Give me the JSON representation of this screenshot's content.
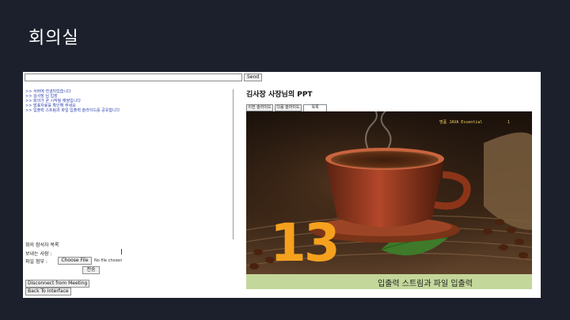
{
  "page": {
    "title": "회의실"
  },
  "chat": {
    "input_value": "",
    "send_label": "Send",
    "messages": [
      ">> 서버에 연결되었습니다",
      ">> 김사장 님 입장",
      ">> 회의가 곧 시작될 예정입니다",
      ">> 발표자료를 확인해 주세요",
      ">> 입출력 스트림과 파일 입출력 슬라이드를 공유합니다"
    ]
  },
  "form": {
    "attendance_label": "회의 참석자 목록",
    "name_label": "보내는 사람 :",
    "name_value": "",
    "file_label": "파일 첨부 :",
    "choose_file_label": "Choose File",
    "no_file_label": "No file chosen",
    "submit_label": "전송",
    "disconnect_label": "Disconnect from Meeting",
    "back_label": "Back To Interface"
  },
  "presentation": {
    "title": "김사장 사장님의 PPT",
    "tabs": [
      "이전 슬라이드",
      "다음 슬라이드",
      "목록"
    ],
    "active_tab": 2,
    "slide": {
      "header": "명품 JAVA Essential",
      "page": "1",
      "number": "13",
      "footer": "입출력 스트림과 파일 입출력",
      "colors": {
        "number": "#f5a11e",
        "footer_bg": "#c4d79b",
        "header": "#f0d060"
      }
    }
  }
}
